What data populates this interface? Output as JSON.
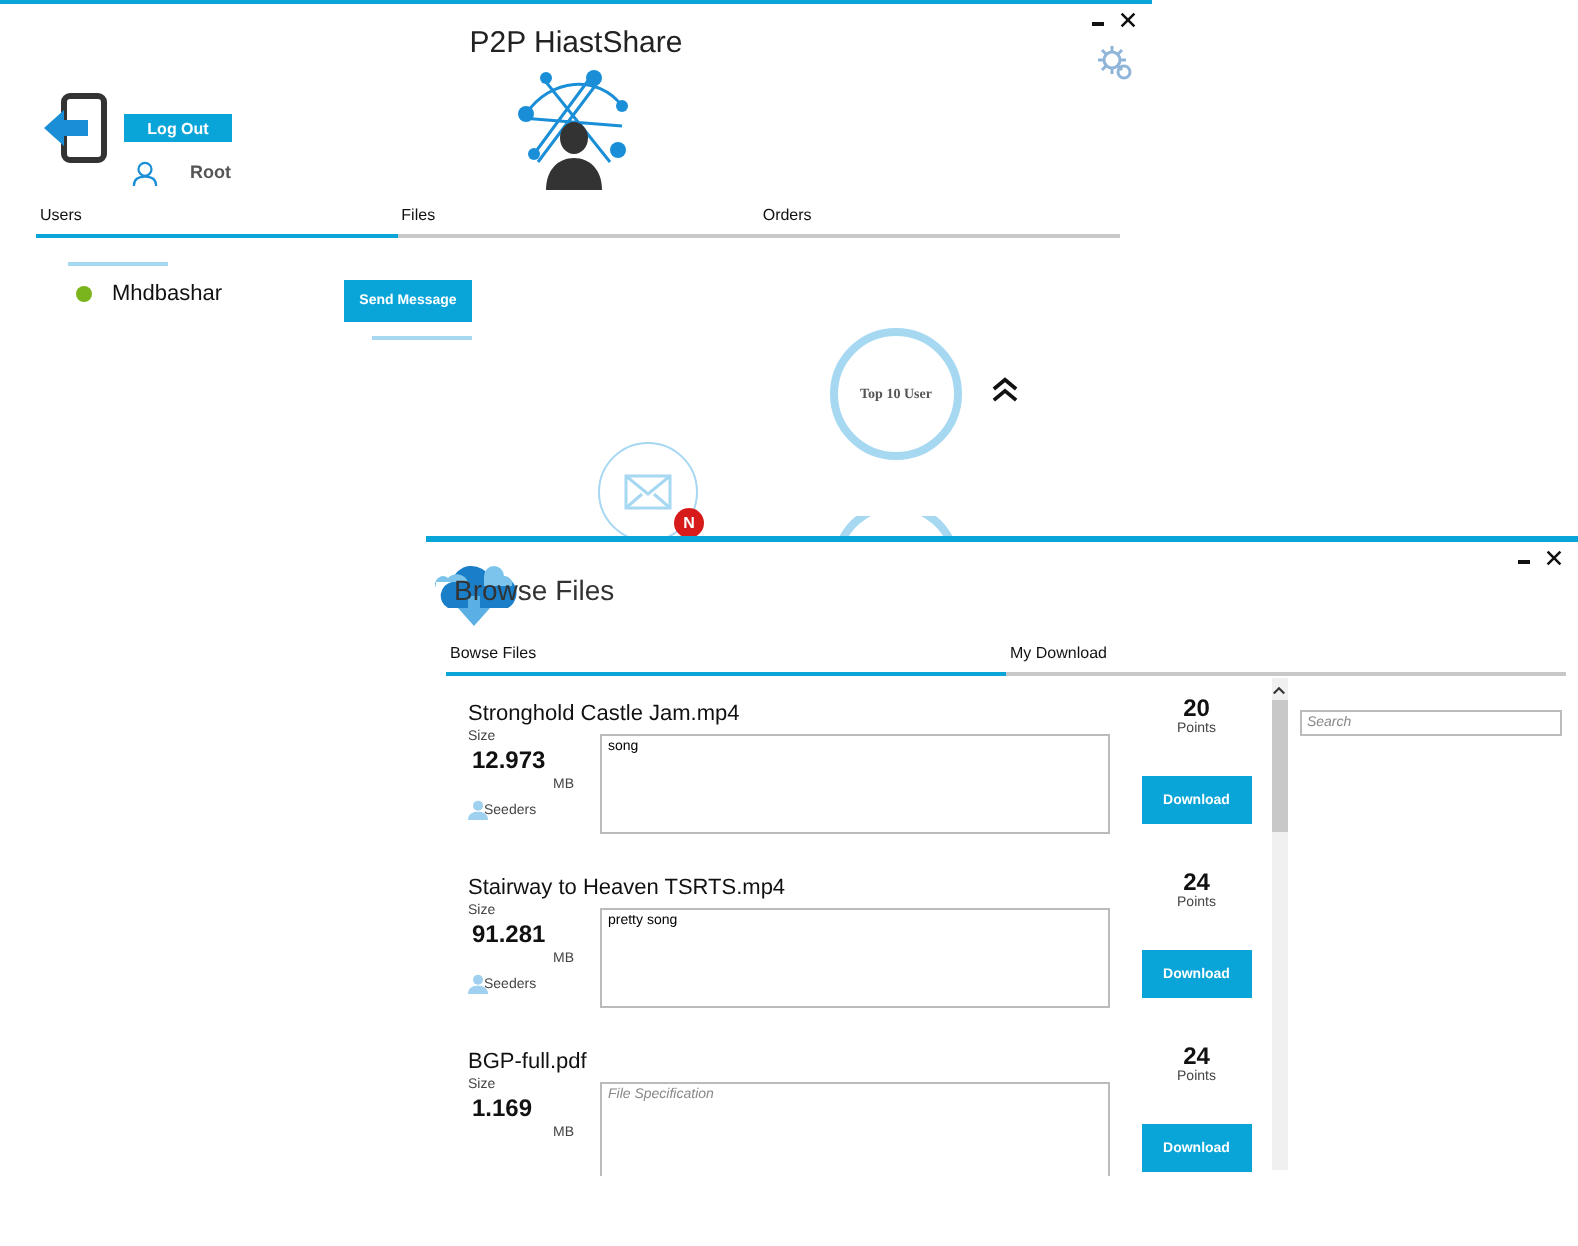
{
  "main_window": {
    "title": "P2P HiastShare",
    "logout_button": "Log Out",
    "username": "Root",
    "tabs": [
      {
        "label": "Users",
        "selected": true
      },
      {
        "label": "Files",
        "selected": false
      },
      {
        "label": "Orders",
        "selected": false
      }
    ],
    "users": [
      {
        "name": "Mhdbashar",
        "online": true
      }
    ],
    "send_button": "Send Message",
    "top_users_button": "Top 10 User",
    "new_badge": "N"
  },
  "browse_window": {
    "title": "Browse Files",
    "tabs": [
      {
        "label": "Bowse Files",
        "selected": true
      },
      {
        "label": "My Download",
        "selected": false
      }
    ],
    "search": {
      "placeholder": "Search"
    },
    "files": [
      {
        "name": "Stronghold Castle Jam.mp4",
        "size_label": "Size",
        "size": "12.973",
        "unit": "MB",
        "seeders": "Seeders",
        "description": "song",
        "points": "20",
        "points_label": "Points",
        "button": "Download"
      },
      {
        "name": "Stairway to Heaven TSRTS.mp4",
        "size_label": "Size",
        "size": "91.281",
        "unit": "MB",
        "seeders": "Seeders",
        "description": "pretty song",
        "points": "24",
        "points_label": "Points",
        "button": "Download"
      },
      {
        "name": "BGP-full.pdf",
        "size_label": "Size",
        "size": "1.169",
        "unit": "MB",
        "placeholder": "File Specification",
        "points": "24",
        "points_label": "Points",
        "button": "Download"
      }
    ]
  }
}
